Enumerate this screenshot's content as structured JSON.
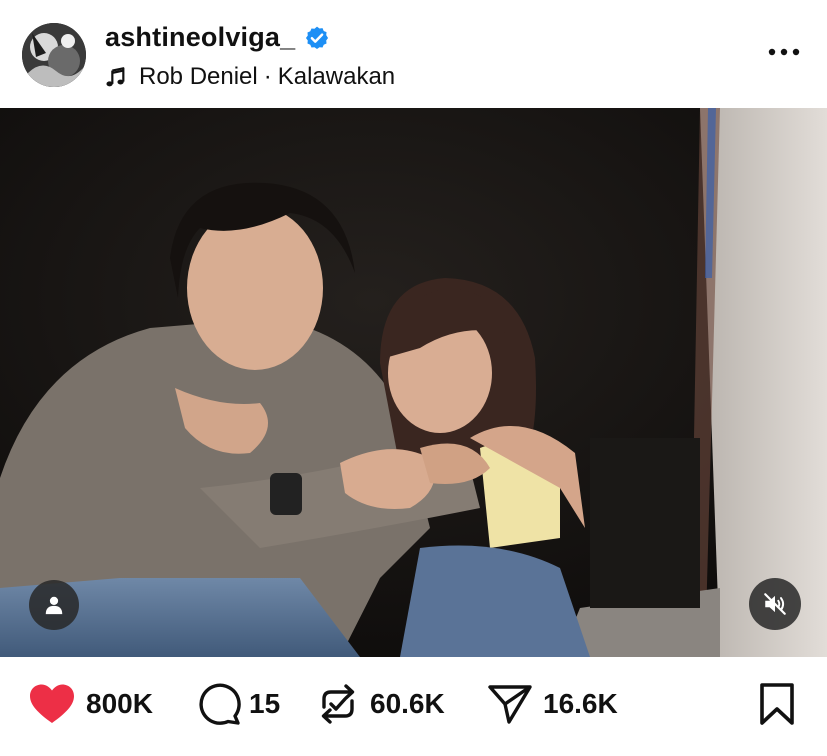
{
  "post": {
    "username": "ashtineolviga_",
    "verified": true,
    "music": {
      "artist": "Rob Deniel",
      "separator": "·",
      "song": "Kalawakan"
    }
  },
  "actions": {
    "likes": "800K",
    "comments": "15",
    "reposts": "60.6K",
    "shares": "16.6K"
  },
  "icons": {
    "verified": "verified-badge-icon",
    "music": "music-note-icon",
    "more": "more-options-icon",
    "tag": "person-tag-icon",
    "mute": "speaker-muted-icon",
    "like": "heart-icon",
    "comment": "comment-bubble-icon",
    "repost": "repost-icon",
    "share": "send-icon",
    "save": "bookmark-icon"
  },
  "colors": {
    "like": "#ed2f46",
    "verified": "#1d8ff5"
  }
}
